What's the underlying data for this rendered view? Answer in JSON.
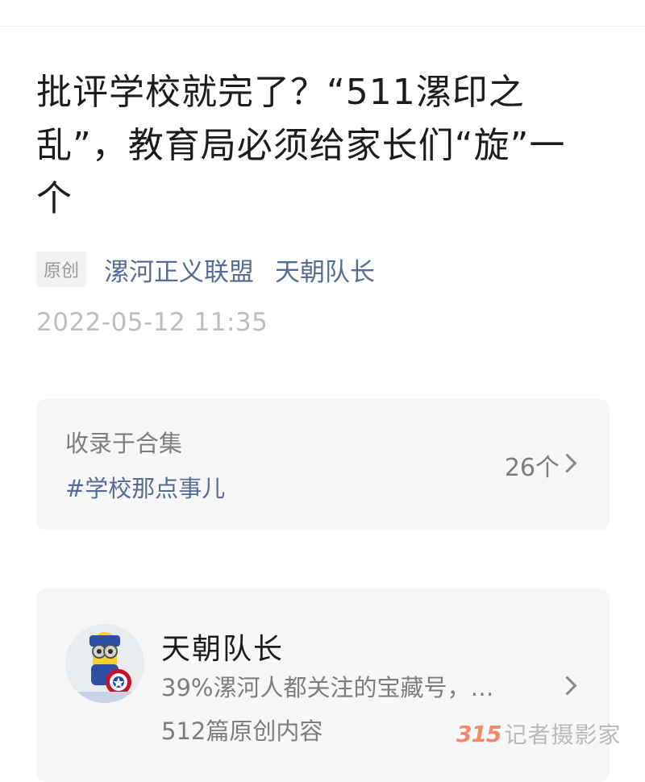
{
  "article": {
    "title": "批评学校就完了？“511漯印之乱”，教育局必须给家长们“旋”一个",
    "badge": "原创",
    "source": "漯河正义联盟",
    "author": "天朝队长",
    "date": "2022-05-12 11:35"
  },
  "collection": {
    "label": "收录于合集",
    "tag": "#学校那点事儿",
    "count": "26个",
    "icon": "chevron-right-icon"
  },
  "account": {
    "name": "天朝队长",
    "description": "39%漯河人都关注的宝藏号，…",
    "post_count": "512篇原创内容",
    "icon": "chevron-right-icon"
  },
  "watermark": {
    "number": "315",
    "text": "记者摄影家"
  },
  "colors": {
    "link": "#576b95",
    "muted": "#7d7d7d",
    "card_bg": "#f7f7f7",
    "date": "#bdbdbd"
  }
}
